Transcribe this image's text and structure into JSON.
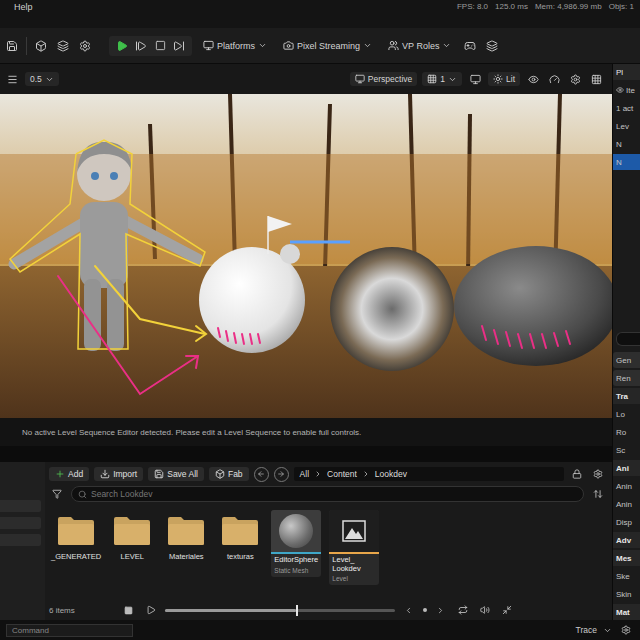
{
  "menu_bar": {
    "items": [
      "Help"
    ],
    "stats": [
      "FPS: 8.0",
      "125.0 ms",
      "Mem: 4,986.99 mb",
      "Objs: 1"
    ]
  },
  "toolbar": {
    "buttons": [
      "Platforms",
      "Pixel Streaming",
      "VP Roles"
    ]
  },
  "viewport": {
    "toolbar": {
      "camera_speed": "0.5",
      "view": "Perspective",
      "layout": "1",
      "view_mode": "Lit"
    },
    "message": "No active Level Sequence Editor detected. Please edit a Level Sequence to enable full controls."
  },
  "content_browser": {
    "buttons": [
      "Add",
      "Import",
      "Save All",
      "Fab"
    ],
    "path": [
      "All",
      "Content",
      "Lookdev"
    ],
    "search_placeholder": "Search Lookdev",
    "items": [
      {
        "name": "_GENERATED",
        "kind": "folder"
      },
      {
        "name": "LEVEL",
        "kind": "folder"
      },
      {
        "name": "Materiales",
        "kind": "folder"
      },
      {
        "name": "texturas",
        "kind": "folder"
      },
      {
        "name": "EditorSphere",
        "kind": "mesh",
        "type": "Static Mesh",
        "color": "#3fa7c7"
      },
      {
        "name": "Level_ Lookdev",
        "kind": "level",
        "type": "Level",
        "color": "#e8a64a"
      }
    ],
    "count": "6 items"
  },
  "sequencer": {
    "level": 0.57
  },
  "outliner": {
    "items": [
      {
        "label": "Pl",
        "kind": "tab",
        "selected": false
      },
      {
        "label": "Ite",
        "kind": "header",
        "selected": false
      },
      {
        "label": "1 act",
        "kind": "count",
        "selected": false
      },
      {
        "label": "Lev",
        "kind": "row",
        "selected": false
      },
      {
        "label": "N",
        "kind": "row",
        "selected": false
      },
      {
        "label": "N",
        "kind": "row",
        "selected": true
      }
    ]
  },
  "details": {
    "items": [
      {
        "label": "Gen",
        "kind": "button"
      },
      {
        "label": "Ren",
        "kind": "button"
      },
      {
        "label": "Tra",
        "kind": "section"
      },
      {
        "label": "Lo",
        "kind": "prop"
      },
      {
        "label": "Ro",
        "kind": "prop"
      },
      {
        "label": "Sc",
        "kind": "prop"
      },
      {
        "label": "Ani",
        "kind": "section"
      },
      {
        "label": "Anin",
        "kind": "prop"
      },
      {
        "label": "Anin",
        "kind": "prop"
      },
      {
        "label": "Disp",
        "kind": "prop"
      },
      {
        "label": "Adv",
        "kind": "section"
      },
      {
        "label": "Mes",
        "kind": "section"
      },
      {
        "label": "Ske",
        "kind": "prop"
      },
      {
        "label": "Skin",
        "kind": "prop"
      },
      {
        "label": "Mat",
        "kind": "section"
      }
    ]
  },
  "status_bar": {
    "command_placeholder": "Command",
    "trace": "Trace"
  }
}
